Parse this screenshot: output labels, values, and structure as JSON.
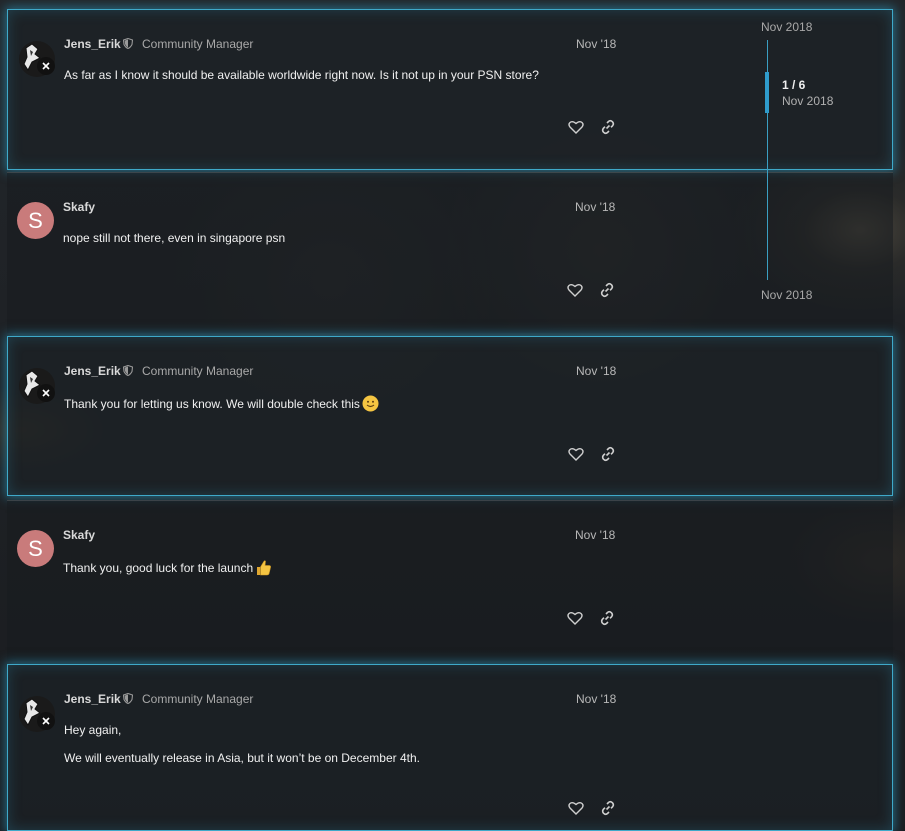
{
  "timeline": {
    "top_date": "Nov 2018",
    "position": "1 / 6",
    "position_date": "Nov 2018",
    "bottom_date": "Nov 2018"
  },
  "posts": [
    {
      "username": "Jens_Erik",
      "role": "Community Manager",
      "date": "Nov '18",
      "lines": [
        "As far as I know it should be available worldwide right now. Is it not up in your PSN store?"
      ]
    },
    {
      "username": "Skafy",
      "avatar_letter": "S",
      "date": "Nov '18",
      "lines": [
        "nope still not there, even in singapore psn"
      ]
    },
    {
      "username": "Jens_Erik",
      "role": "Community Manager",
      "date": "Nov '18",
      "lines": [
        "Thank you for letting us know. We will double check this"
      ],
      "emoji": "slightly-smiling-face"
    },
    {
      "username": "Skafy",
      "avatar_letter": "S",
      "date": "Nov '18",
      "lines": [
        "Thank you, good luck for the launch"
      ],
      "emoji": "thumbs-up"
    },
    {
      "username": "Jens_Erik",
      "role": "Community Manager",
      "date": "Nov '18",
      "lines": [
        "Hey again,",
        "We will eventually release in Asia, but it won’t be on December 4th."
      ]
    }
  ],
  "icons": {
    "like": "heart-icon",
    "share": "link-icon",
    "staff": "shield-icon"
  },
  "colors": {
    "staff_glow": "#3fa9c9",
    "avatar_s": "#c97b7b",
    "timeline": "#2f9ccc"
  }
}
